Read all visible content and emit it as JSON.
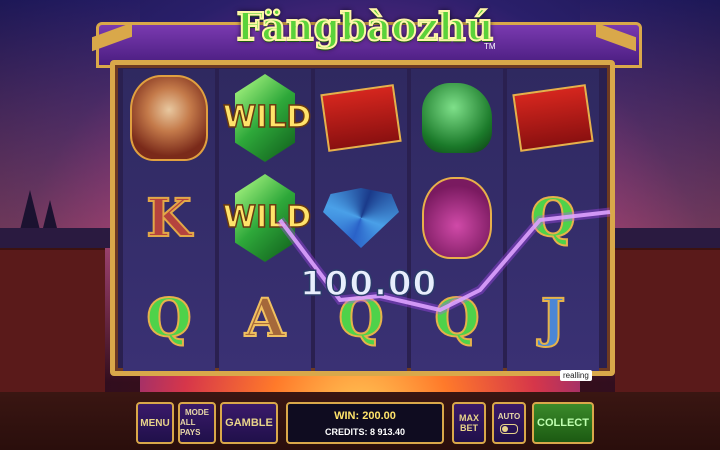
{
  "game": {
    "logo_text": "Fängbàozhú",
    "logo_tm": "TM",
    "brand": "realling"
  },
  "reels": [
    {
      "symbols": [
        "mask-icon",
        "K",
        "Q"
      ]
    },
    {
      "symbols": [
        "wild",
        "wild",
        "A"
      ]
    },
    {
      "symbols": [
        "envelope-icon",
        "fan-icon",
        "Q"
      ]
    },
    {
      "symbols": [
        "lion-icon",
        "bag-icon",
        "Q"
      ]
    },
    {
      "symbols": [
        "envelope-icon",
        "Q",
        "J"
      ]
    }
  ],
  "wild_label": "WILD",
  "line_win": "100.00",
  "controls": {
    "menu": "MENU",
    "mode_label": "MODE",
    "mode_value": "ALL PAYS",
    "gamble": "GAMBLE",
    "win_label": "WIN:",
    "win_value": "200.00",
    "credits_label": "CREDITS:",
    "credits_value": "8 913.40",
    "max_bet_1": "MAX",
    "max_bet_2": "BET",
    "auto": "AUTO",
    "collect": "COLLECT"
  },
  "colors": {
    "frame_gold": "#d9a84a",
    "win_line": "#e8a8ff",
    "collect_green": "#3a8a2a"
  }
}
